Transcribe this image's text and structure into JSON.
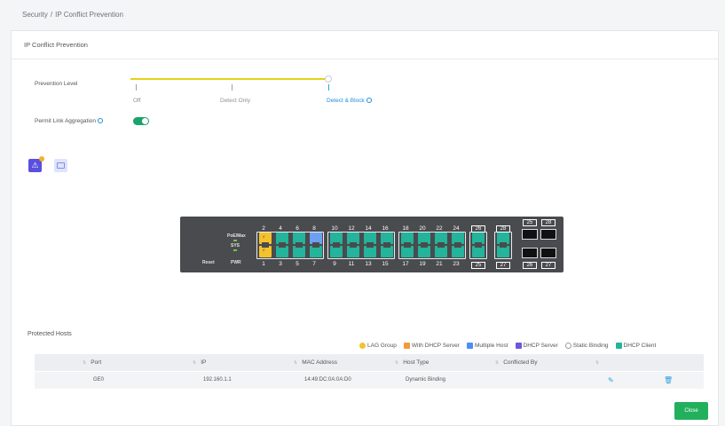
{
  "breadcrumb": {
    "section": "Security",
    "separator": "/",
    "page": "IP Conflict Prevention"
  },
  "panel": {
    "title": "IP Conflict Prevention"
  },
  "prevention": {
    "label": "Prevention Level",
    "levels": [
      "Off",
      "Detect Only",
      "Detect & Block"
    ],
    "selected": "Detect & Block"
  },
  "lag": {
    "label": "Permit Link Aggregation",
    "enabled": true
  },
  "switch": {
    "labels": {
      "poe": "PoE/Max",
      "sys": "SYS",
      "pwr": "PWR",
      "reset": "Reset"
    },
    "top_numbers": [
      "2",
      "4",
      "6",
      "8",
      "10",
      "12",
      "14",
      "16",
      "18",
      "20",
      "22",
      "24",
      "26",
      "28",
      "25",
      "28"
    ],
    "bottom_numbers": [
      "1",
      "3",
      "5",
      "7",
      "9",
      "11",
      "13",
      "15",
      "17",
      "19",
      "21",
      "23",
      "25",
      "27",
      "26",
      "27"
    ]
  },
  "legend": [
    {
      "label": "LAG Group",
      "icon": "lag-group-icon",
      "color": "#f4c22d"
    },
    {
      "label": "With DHCP Server",
      "icon": "with-dhcp-server-icon",
      "color": "#f19a3a"
    },
    {
      "label": "Multiple Host",
      "icon": "multiple-host-icon",
      "color": "#4c8ff0"
    },
    {
      "label": "DHCP Server",
      "icon": "dhcp-server-icon",
      "color": "#6a5ad8"
    },
    {
      "label": "Static Binding",
      "icon": "static-binding-icon",
      "color": "#9aa0a6"
    },
    {
      "label": "DHCP Client",
      "icon": "dhcp-client-icon",
      "color": "#23b49b"
    }
  ],
  "protected_hosts": {
    "title": "Protected Hosts",
    "columns": [
      "Port",
      "IP",
      "MAC Address",
      "Host Type",
      "Conflicted By"
    ],
    "rows": [
      {
        "port": "GE0",
        "ip": "192.160.1.1",
        "mac": "14:49:DC:0A:0A:D0",
        "host_type": "Dynamic Binding",
        "conflicted_by": ""
      }
    ]
  },
  "buttons": {
    "close": "Close"
  }
}
